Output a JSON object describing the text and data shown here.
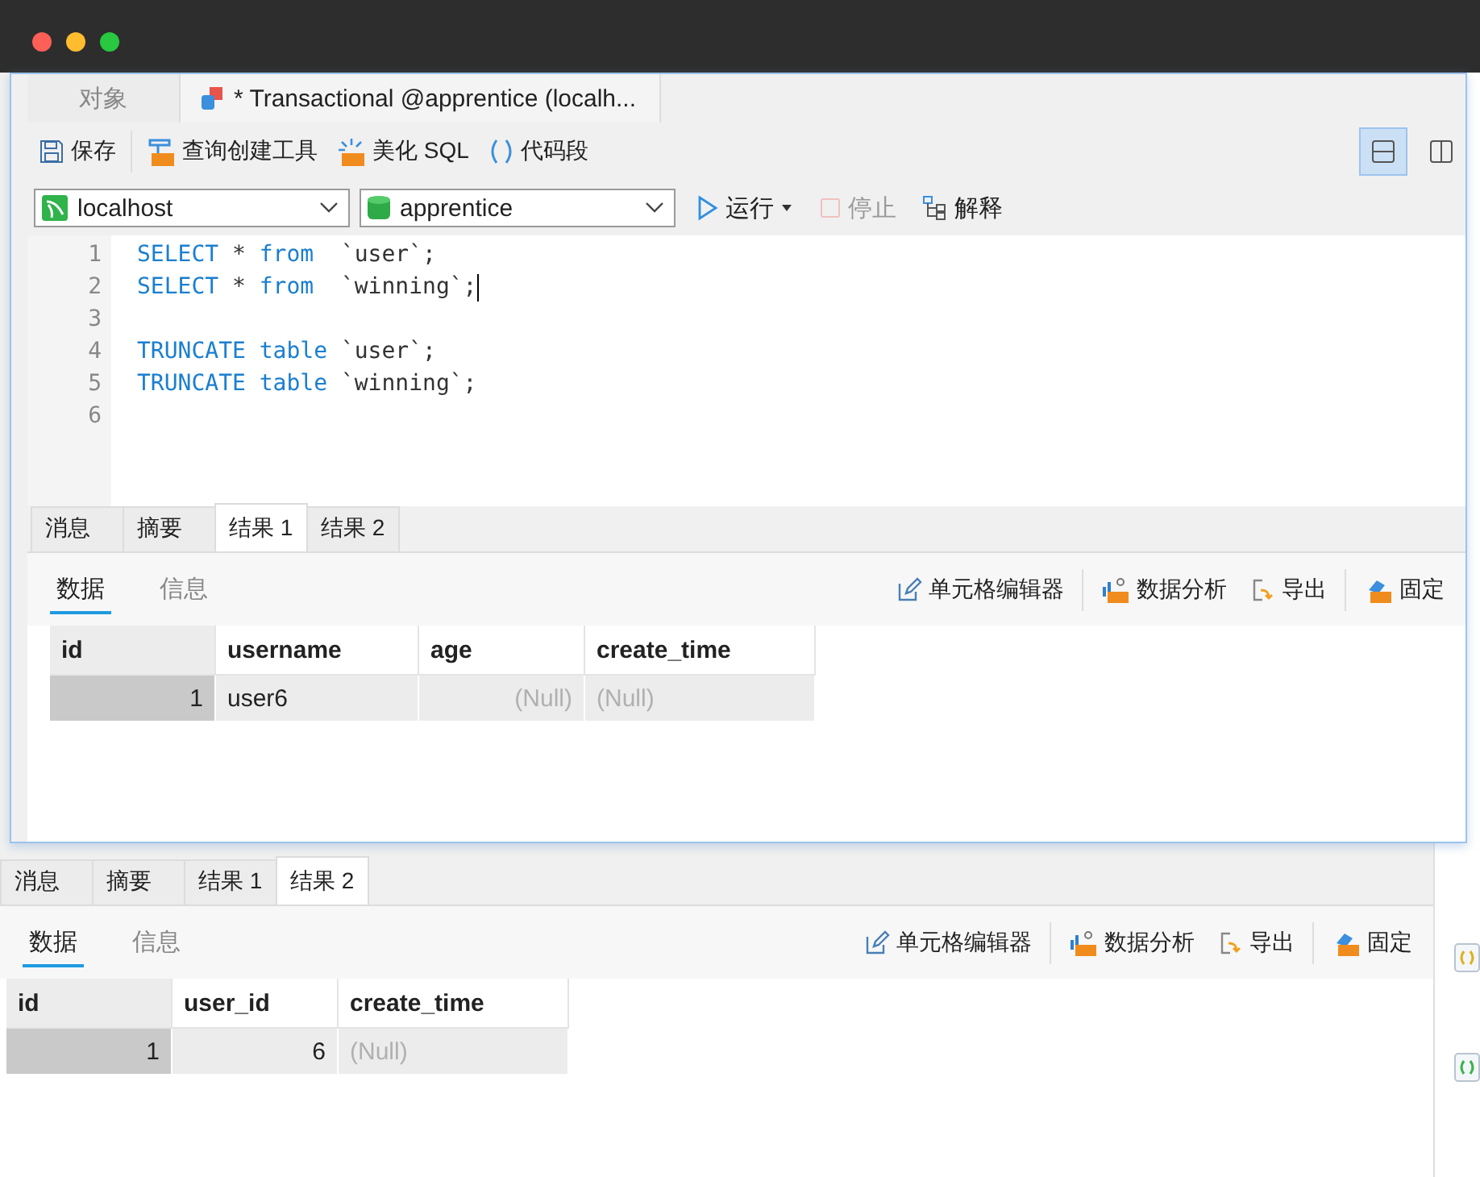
{
  "window": {
    "controls": [
      {
        "color": "#fe5f57"
      },
      {
        "color": "#febc2e"
      },
      {
        "color": "#28c840"
      }
    ]
  },
  "front_window": {
    "tabs": [
      {
        "label": "对象",
        "kind": "plain",
        "selected": false
      },
      {
        "label": "* Transactional @apprentice (localh...",
        "kind": "query",
        "selected": true
      }
    ],
    "toolbar": [
      {
        "label": "保存",
        "kind": "save"
      },
      {
        "label": "查询创建工具",
        "kind": "builder"
      },
      {
        "label": "美化 SQL",
        "kind": "beautify"
      },
      {
        "label": "代码段",
        "kind": "snippet"
      }
    ],
    "layout_toggles": [
      {
        "kind": "stacked",
        "selected": true
      },
      {
        "kind": "side",
        "selected": false
      }
    ],
    "connection": {
      "value": "localhost"
    },
    "database": {
      "value": "apprentice"
    },
    "actions": [
      {
        "label": "运行",
        "kind": "run",
        "disabled": false
      },
      {
        "label": "停止",
        "kind": "stop",
        "disabled": true
      },
      {
        "label": "解释",
        "kind": "explain",
        "disabled": false
      }
    ],
    "editor": {
      "lines": [
        {
          "number": "1",
          "caret": false,
          "tokens": [
            {
              "kind": "keyword",
              "text": "SELECT"
            },
            {
              "kind": "plain",
              "text": " * "
            },
            {
              "kind": "keyword",
              "text": "from"
            },
            {
              "kind": "plain",
              "text": "  `user`;"
            }
          ]
        },
        {
          "number": "2",
          "caret": true,
          "tokens": [
            {
              "kind": "keyword",
              "text": "SELECT"
            },
            {
              "kind": "plain",
              "text": " * "
            },
            {
              "kind": "keyword",
              "text": "from"
            },
            {
              "kind": "plain",
              "text": "  `winning`;"
            }
          ]
        },
        {
          "number": "3",
          "caret": false
        },
        {
          "number": "4",
          "caret": false,
          "tokens": [
            {
              "kind": "keyword",
              "text": "TRUNCATE table"
            },
            {
              "kind": "plain",
              "text": " `user`;"
            }
          ]
        },
        {
          "number": "5",
          "caret": false,
          "tokens": [
            {
              "kind": "keyword",
              "text": "TRUNCATE table"
            },
            {
              "kind": "plain",
              "text": " `winning`;"
            }
          ]
        },
        {
          "number": "6",
          "caret": false
        }
      ]
    },
    "result_tabs": [
      {
        "label": "消息",
        "selected": false
      },
      {
        "label": "摘要",
        "selected": false
      },
      {
        "label": "结果 1",
        "selected": true
      },
      {
        "label": "结果 2",
        "selected": false
      }
    ],
    "sub_tabs": [
      {
        "label": "数据",
        "selected": true
      },
      {
        "label": "信息",
        "selected": false
      }
    ],
    "result_toolbar": [
      {
        "label": "单元格编辑器",
        "kind": "edit"
      },
      {
        "label": "数据分析",
        "kind": "analysis"
      },
      {
        "label": "导出",
        "kind": "export"
      },
      {
        "label": "固定",
        "kind": "pin"
      }
    ],
    "table": {
      "columns": [
        {
          "label": "id",
          "kind": "key"
        },
        {
          "label": "username",
          "kind": "text"
        },
        {
          "label": "age",
          "kind": "number"
        },
        {
          "label": "create_time",
          "kind": "text"
        }
      ],
      "rows": [
        [
          {
            "text": "1",
            "null": false
          },
          {
            "text": "user6",
            "null": false
          },
          {
            "text": "(Null)",
            "null": true
          },
          {
            "text": "(Null)",
            "null": true
          }
        ]
      ]
    }
  },
  "back_window": {
    "result_tabs": [
      {
        "label": "消息",
        "selected": false
      },
      {
        "label": "摘要",
        "selected": false
      },
      {
        "label": "结果 1",
        "selected": false
      },
      {
        "label": "结果 2",
        "selected": true
      }
    ],
    "sub_tabs": [
      {
        "label": "数据",
        "selected": true
      },
      {
        "label": "信息",
        "selected": false
      }
    ],
    "result_toolbar": [
      {
        "label": "单元格编辑器",
        "kind": "edit"
      },
      {
        "label": "数据分析",
        "kind": "analysis"
      },
      {
        "label": "导出",
        "kind": "export"
      },
      {
        "label": "固定",
        "kind": "pin"
      }
    ],
    "table": {
      "columns": [
        {
          "label": "id",
          "kind": "key"
        },
        {
          "label": "user_id",
          "kind": "number"
        },
        {
          "label": "create_time",
          "kind": "text"
        }
      ],
      "rows": [
        [
          {
            "text": "1",
            "null": false
          },
          {
            "text": "6",
            "null": false
          },
          {
            "text": "(Null)",
            "null": true
          }
        ]
      ]
    }
  }
}
